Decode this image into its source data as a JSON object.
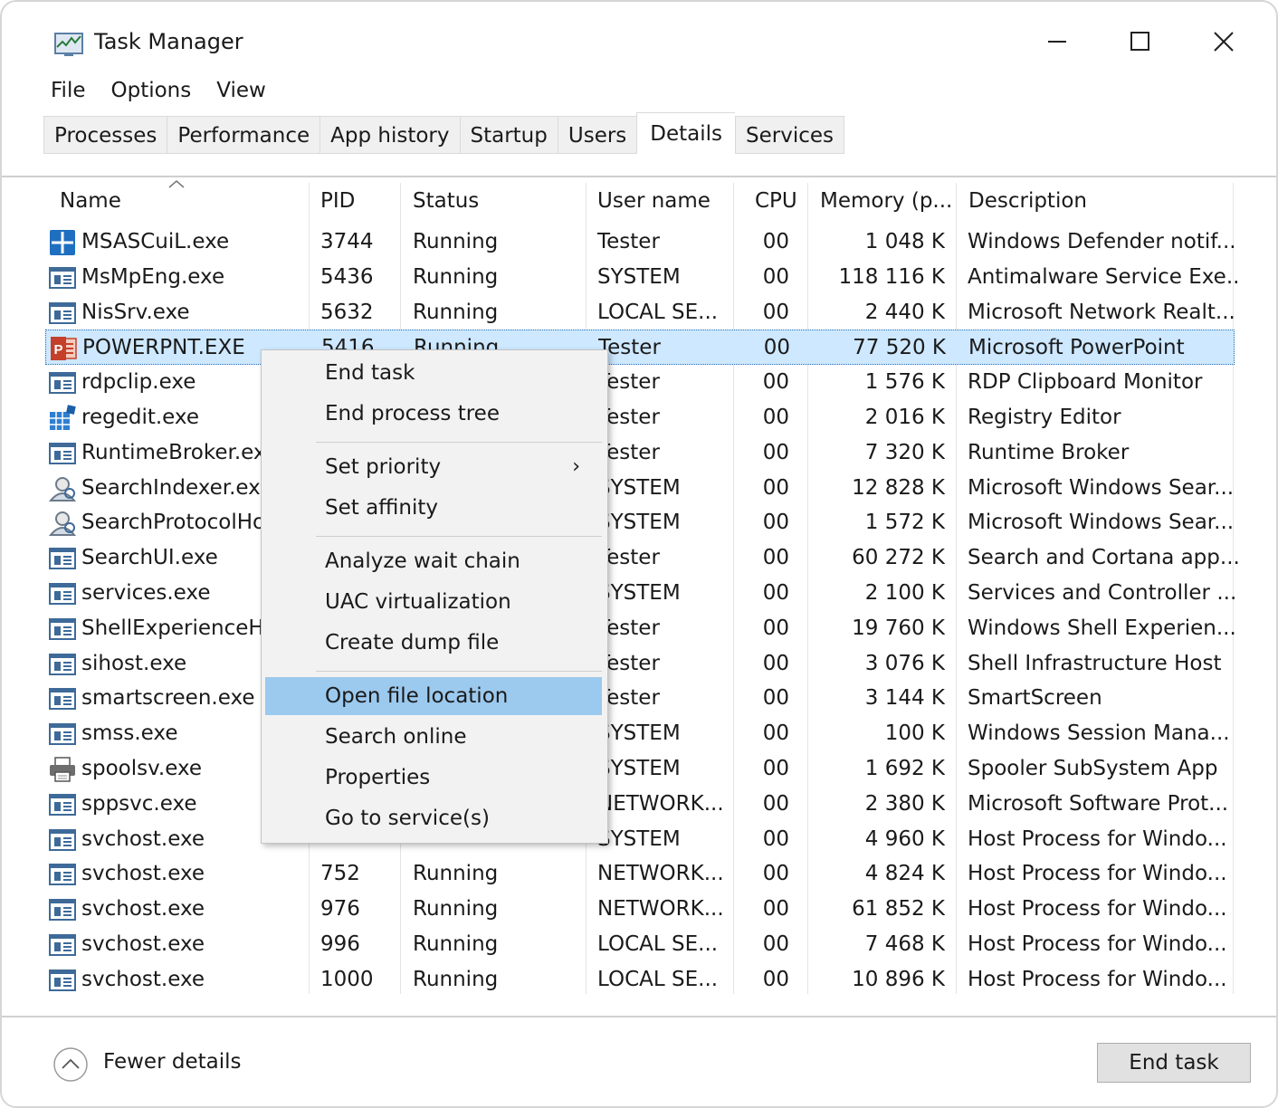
{
  "window": {
    "title": "Task Manager"
  },
  "menu": [
    "File",
    "Options",
    "View"
  ],
  "tabs": [
    "Processes",
    "Performance",
    "App history",
    "Startup",
    "Users",
    "Details",
    "Services"
  ],
  "active_tab": "Details",
  "columns": {
    "name": "Name",
    "pid": "PID",
    "status": "Status",
    "user": "User name",
    "cpu": "CPU",
    "memory": "Memory (p...",
    "description": "Description"
  },
  "rows": [
    {
      "name": "MSASCuiL.exe",
      "pid": "3744",
      "status": "Running",
      "user": "Tester",
      "cpu": "00",
      "memory": "1 048 K",
      "description": "Windows Defender notif...",
      "icon": "shield-icon"
    },
    {
      "name": "MsMpEng.exe",
      "pid": "5436",
      "status": "Running",
      "user": "SYSTEM",
      "cpu": "00",
      "memory": "118 116 K",
      "description": "Antimalware Service Exe...",
      "icon": "app-window-icon"
    },
    {
      "name": "NisSrv.exe",
      "pid": "5632",
      "status": "Running",
      "user": "LOCAL SE...",
      "cpu": "00",
      "memory": "2 440 K",
      "description": "Microsoft Network Realt...",
      "icon": "app-window-icon"
    },
    {
      "name": "POWERPNT.EXE",
      "pid": "5416",
      "status": "Running",
      "user": "Tester",
      "cpu": "00",
      "memory": "77 520 K",
      "description": "Microsoft PowerPoint",
      "icon": "powerpoint-icon",
      "selected": true
    },
    {
      "name": "rdpclip.exe",
      "pid": "",
      "status": "",
      "user": "Tester",
      "cpu": "00",
      "memory": "1 576 K",
      "description": "RDP Clipboard Monitor",
      "icon": "app-window-icon"
    },
    {
      "name": "regedit.exe",
      "pid": "",
      "status": "",
      "user": "Tester",
      "cpu": "00",
      "memory": "2 016 K",
      "description": "Registry Editor",
      "icon": "registry-icon"
    },
    {
      "name": "RuntimeBroker.exe",
      "pid": "",
      "status": "",
      "user": "Tester",
      "cpu": "00",
      "memory": "7 320 K",
      "description": "Runtime Broker",
      "icon": "app-window-icon"
    },
    {
      "name": "SearchIndexer.exe",
      "pid": "",
      "status": "",
      "user": "SYSTEM",
      "cpu": "00",
      "memory": "12 828 K",
      "description": "Microsoft Windows Sear...",
      "icon": "search-indexer-icon"
    },
    {
      "name": "SearchProtocolHost.exe",
      "pid": "",
      "status": "",
      "user": "SYSTEM",
      "cpu": "00",
      "memory": "1 572 K",
      "description": "Microsoft Windows Sear...",
      "icon": "search-indexer-icon"
    },
    {
      "name": "SearchUI.exe",
      "pid": "",
      "status": "",
      "user": "Tester",
      "cpu": "00",
      "memory": "60 272 K",
      "description": "Search and Cortana app...",
      "icon": "app-window-icon"
    },
    {
      "name": "services.exe",
      "pid": "",
      "status": "",
      "user": "SYSTEM",
      "cpu": "00",
      "memory": "2 100 K",
      "description": "Services and Controller ...",
      "icon": "app-window-icon"
    },
    {
      "name": "ShellExperienceHost.exe",
      "pid": "",
      "status": "",
      "user": "Tester",
      "cpu": "00",
      "memory": "19 760 K",
      "description": "Windows Shell Experien...",
      "icon": "app-window-icon"
    },
    {
      "name": "sihost.exe",
      "pid": "",
      "status": "",
      "user": "Tester",
      "cpu": "00",
      "memory": "3 076 K",
      "description": "Shell Infrastructure Host",
      "icon": "app-window-icon"
    },
    {
      "name": "smartscreen.exe",
      "pid": "",
      "status": "",
      "user": "Tester",
      "cpu": "00",
      "memory": "3 144 K",
      "description": "SmartScreen",
      "icon": "app-window-icon"
    },
    {
      "name": "smss.exe",
      "pid": "",
      "status": "",
      "user": "SYSTEM",
      "cpu": "00",
      "memory": "100 K",
      "description": "Windows Session Mana...",
      "icon": "app-window-icon"
    },
    {
      "name": "spoolsv.exe",
      "pid": "",
      "status": "",
      "user": "SYSTEM",
      "cpu": "00",
      "memory": "1 692 K",
      "description": "Spooler SubSystem App",
      "icon": "printer-icon"
    },
    {
      "name": "sppsvc.exe",
      "pid": "",
      "status": "",
      "user": "NETWORK...",
      "cpu": "00",
      "memory": "2 380 K",
      "description": "Microsoft Software Prot...",
      "icon": "app-window-icon"
    },
    {
      "name": "svchost.exe",
      "pid": "",
      "status": "",
      "user": "SYSTEM",
      "cpu": "00",
      "memory": "4 960 K",
      "description": "Host Process for Windo...",
      "icon": "app-window-icon"
    },
    {
      "name": "svchost.exe",
      "pid": "752",
      "status": "Running",
      "user": "NETWORK...",
      "cpu": "00",
      "memory": "4 824 K",
      "description": "Host Process for Windo...",
      "icon": "app-window-icon"
    },
    {
      "name": "svchost.exe",
      "pid": "976",
      "status": "Running",
      "user": "NETWORK...",
      "cpu": "00",
      "memory": "61 852 K",
      "description": "Host Process for Windo...",
      "icon": "app-window-icon"
    },
    {
      "name": "svchost.exe",
      "pid": "996",
      "status": "Running",
      "user": "LOCAL SE...",
      "cpu": "00",
      "memory": "7 468 K",
      "description": "Host Process for Windo...",
      "icon": "app-window-icon"
    },
    {
      "name": "svchost.exe",
      "pid": "1000",
      "status": "Running",
      "user": "LOCAL SE...",
      "cpu": "00",
      "memory": "10 896 K",
      "description": "Host Process for Windo...",
      "icon": "app-window-icon"
    }
  ],
  "context_menu": {
    "groups": [
      [
        "End task",
        "End process tree"
      ],
      [
        "Set priority",
        "Set affinity"
      ],
      [
        "Analyze wait chain",
        "UAC virtualization",
        "Create dump file"
      ],
      [
        "Open file location",
        "Search online",
        "Properties",
        "Go to service(s)"
      ]
    ],
    "submenu_item": "Set priority",
    "highlighted": "Open file location"
  },
  "footer": {
    "fewer_details": "Fewer details",
    "end_task": "End task"
  },
  "colors": {
    "selection": "#cde8ff",
    "menu_highlight": "#9cc9ee"
  }
}
